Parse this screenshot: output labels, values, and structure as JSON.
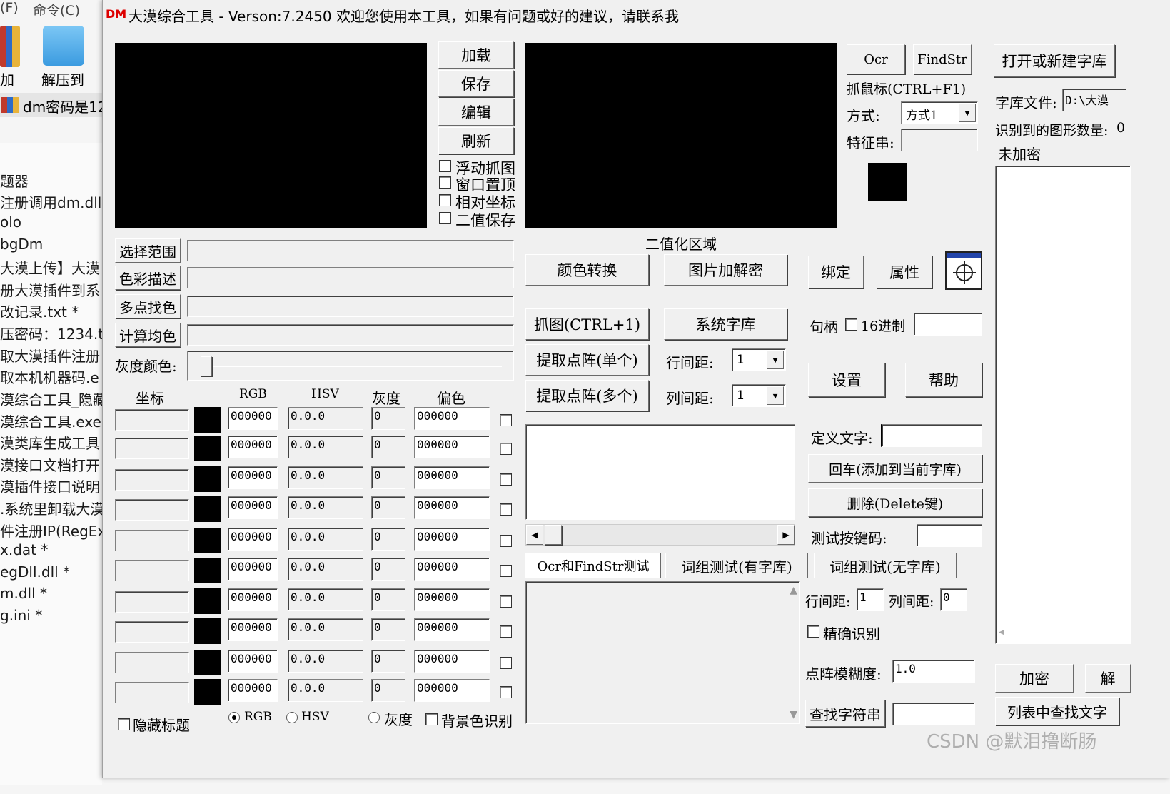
{
  "background": {
    "menu": [
      "(F)",
      "命令(C)"
    ],
    "toolbar": [
      {
        "label": "加",
        "icon": "archive-icon"
      },
      {
        "label": "解压到",
        "icon": "folder-extract-icon"
      }
    ],
    "archive_name": "dm密码是12",
    "files": [
      "题器",
      "注册调用dm.dll",
      "olo",
      "bgDm",
      "大漠上传】大漠",
      "册大漠插件到系",
      "改记录.txt *",
      "压密码：1234.t",
      "取大漠插件注册",
      "取本机机器码.e",
      "漠综合工具_隐藏",
      "漠综合工具.exe",
      "漠类库生成工具",
      "漠接口文档打开",
      "漠插件接口说明",
      ".系统里卸载大漠",
      "件注册IP(RegEx",
      "x.dat *",
      "egDll.dll *",
      "m.dll *",
      "g.ini *"
    ]
  },
  "title": {
    "icon": "DM",
    "text": "大漠综合工具 -  Verson:7.2450  欢迎您使用本工具，如果有问题或好的建议，请联系我"
  },
  "image_buttons": [
    "加载",
    "保存",
    "编辑",
    "刷新"
  ],
  "image_options": [
    "浮动抓图",
    "窗口置顶",
    "相对坐标",
    "二值保存"
  ],
  "func_buttons": [
    "选择范围",
    "色彩描述",
    "多点找色",
    "计算均色"
  ],
  "gray_label": "灰度颜色:",
  "table": {
    "headers": [
      "坐标",
      "RGB",
      "HSV",
      "灰度",
      "偏色"
    ],
    "rows": [
      {
        "rgb": "000000",
        "hsv": "0.0.0",
        "gray": "0",
        "offset": "000000"
      },
      {
        "rgb": "000000",
        "hsv": "0.0.0",
        "gray": "0",
        "offset": "000000"
      },
      {
        "rgb": "000000",
        "hsv": "0.0.0",
        "gray": "0",
        "offset": "000000"
      },
      {
        "rgb": "000000",
        "hsv": "0.0.0",
        "gray": "0",
        "offset": "000000"
      },
      {
        "rgb": "000000",
        "hsv": "0.0.0",
        "gray": "0",
        "offset": "000000"
      },
      {
        "rgb": "000000",
        "hsv": "0.0.0",
        "gray": "0",
        "offset": "000000"
      },
      {
        "rgb": "000000",
        "hsv": "0.0.0",
        "gray": "0",
        "offset": "000000"
      },
      {
        "rgb": "000000",
        "hsv": "0.0.0",
        "gray": "0",
        "offset": "000000"
      },
      {
        "rgb": "000000",
        "hsv": "0.0.0",
        "gray": "0",
        "offset": "000000"
      },
      {
        "rgb": "000000",
        "hsv": "0.0.0",
        "gray": "0",
        "offset": "000000"
      }
    ]
  },
  "bottom_options": {
    "hide_title": "隐藏标题",
    "rgb": "RGB",
    "hsv": "HSV",
    "gray": "灰度",
    "bg_recog": "背景色识别",
    "selected_mode": "RGB"
  },
  "binary_label": "二值化区域",
  "mid_buttons": {
    "color_convert": "颜色转换",
    "img_encrypt": "图片加解密",
    "capture": "抓图(CTRL+1)",
    "system_lib": "系统字库",
    "extract_single": "提取点阵(单个)",
    "extract_multi": "提取点阵(多个)"
  },
  "line_gap_label": "行间距:",
  "col_gap_label": "列间距:",
  "line_gap_value": "1",
  "col_gap_value": "1",
  "tabs": [
    "Ocr和FindStr测试",
    "词组测试(有字库)",
    "词组测试(无字库)"
  ],
  "right_top": {
    "ocr": "Ocr",
    "findstr": "FindStr",
    "grab_mouse": "抓鼠标(CTRL+F1)",
    "mode_label": "方式:",
    "mode_value": "方式1",
    "feature_label": "特征串:",
    "feature_value": ""
  },
  "right_mid": {
    "bind": "绑定",
    "props": "属性",
    "handle_label": "句柄",
    "hex_label": "16进制",
    "handle_value": "",
    "settings": "设置",
    "help": "帮助",
    "define_label": "定义文字:",
    "define_value": "",
    "add_btn": "回车(添加到当前字库)",
    "delete_btn": "删除(Delete键)",
    "test_key_label": "测试按键码:",
    "test_key_value": ""
  },
  "right_low": {
    "line_gap_label": "行间距:",
    "line_gap_value": "1",
    "col_gap_label": "列间距:",
    "col_gap_value": "0",
    "exact": "精确识别",
    "blur_label": "点阵模糊度:",
    "blur_value": "1.0",
    "find_btn": "查找字符串",
    "find_value": ""
  },
  "library": {
    "open_btn": "打开或新建字库",
    "file_label": "字库文件:",
    "file_value": "D:\\大漠",
    "count_label": "识别到的图形数量:",
    "count_value": "0",
    "status": "未加密",
    "encrypt_btn": "加密",
    "decrypt_btn": "解",
    "find_in_list_btn": "列表中查找文字"
  },
  "watermark": "CSDN @默泪撸断肠"
}
